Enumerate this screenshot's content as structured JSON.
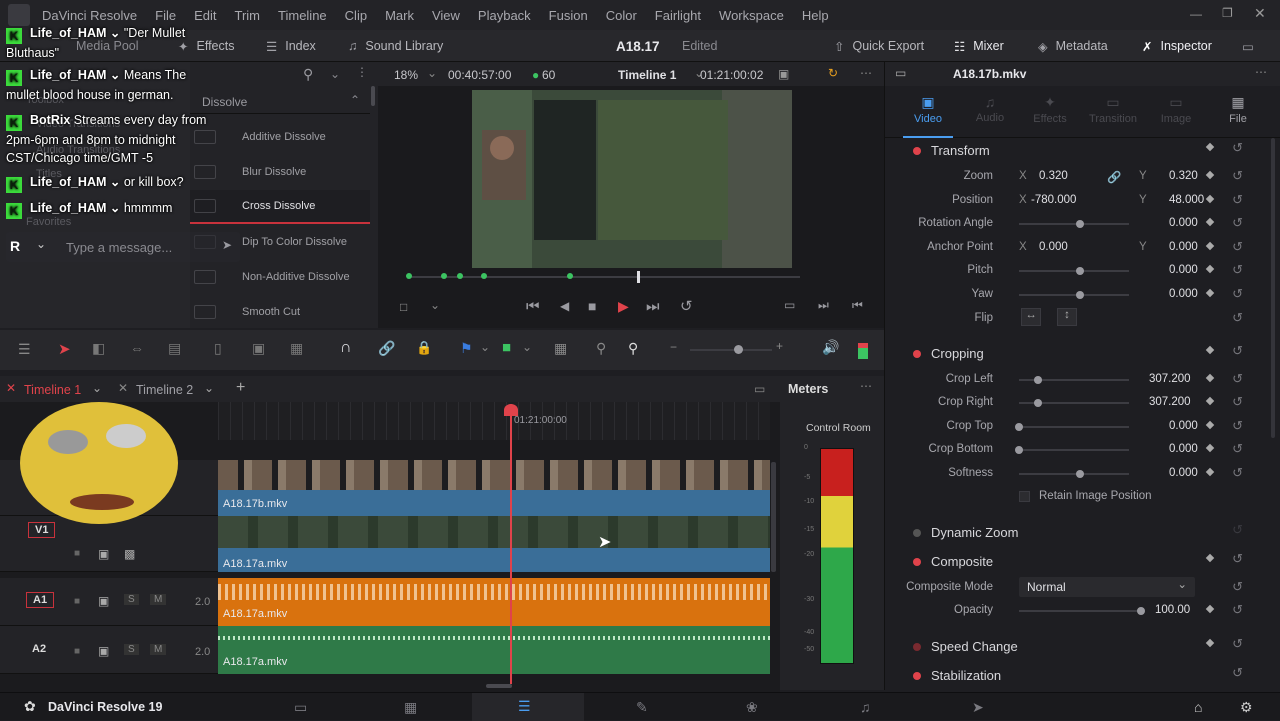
{
  "menu": {
    "app": "DaVinci Resolve",
    "items": [
      "File",
      "Edit",
      "Trim",
      "Timeline",
      "Clip",
      "Mark",
      "View",
      "Playback",
      "Fusion",
      "Color",
      "Fairlight",
      "Workspace",
      "Help"
    ]
  },
  "toolbar": {
    "media_pool": "Media Pool",
    "effects": "Effects",
    "index": "Index",
    "sound_library": "Sound Library",
    "project_name": "A18.17",
    "project_status": "Edited",
    "quick_export": "Quick Export",
    "mixer": "Mixer",
    "metadata": "Metadata",
    "inspector": "Inspector"
  },
  "effects": {
    "sidebar": [
      "Toolbox",
      "Video Transitions",
      "Audio Transitions",
      "Titles",
      "Favorites"
    ],
    "group": "Dissolve",
    "items": [
      "Additive Dissolve",
      "Blur Dissolve",
      "Cross Dissolve",
      "Dip To Color Dissolve",
      "Non-Additive Dissolve",
      "Smooth Cut"
    ],
    "selected": "Cross Dissolve"
  },
  "chat": {
    "messages": [
      {
        "user": "Life_of_HAM",
        "text": "\"Der Mullet Bluthaus\""
      },
      {
        "user": "Life_of_HAM",
        "text": "Means The mullet blood house in german."
      },
      {
        "user": "BotRix",
        "text": "Streams every day from 2pm-6pm and 8pm to midnight CST/Chicago time/GMT -5"
      },
      {
        "user": "Life_of_HAM",
        "text": "or kill box?"
      },
      {
        "user": "Life_of_HAM",
        "text": "hmmmm"
      }
    ],
    "input_initial": "R",
    "input_placeholder": "Type a message..."
  },
  "viewer": {
    "zoom": "18%",
    "source_tc": "00:40:57:00",
    "fps": "60",
    "timeline_name": "Timeline 1",
    "record_tc": "01:21:00:02"
  },
  "inspector": {
    "clip_name": "A18.17b.mkv",
    "tabs": [
      "Video",
      "Audio",
      "Effects",
      "Transition",
      "Image",
      "File"
    ],
    "active_tab": "Video",
    "transform": {
      "title": "Transform",
      "zoom_label": "Zoom",
      "zoom_x": "0.320",
      "zoom_y": "0.320",
      "position_label": "Position",
      "position_x": "-780.000",
      "position_y": "48.000",
      "rotation_label": "Rotation Angle",
      "rotation": "0.000",
      "anchor_label": "Anchor Point",
      "anchor_x": "0.000",
      "anchor_y": "0.000",
      "pitch_label": "Pitch",
      "pitch": "0.000",
      "yaw_label": "Yaw",
      "yaw": "0.000",
      "flip_label": "Flip",
      "x_axis": "X",
      "y_axis": "Y"
    },
    "cropping": {
      "title": "Cropping",
      "left_label": "Crop Left",
      "left": "307.200",
      "right_label": "Crop Right",
      "right": "307.200",
      "top_label": "Crop Top",
      "top": "0.000",
      "bottom_label": "Crop Bottom",
      "bottom": "0.000",
      "softness_label": "Softness",
      "softness": "0.000",
      "retain_label": "Retain Image Position"
    },
    "dynamic_zoom": "Dynamic Zoom",
    "composite": {
      "title": "Composite",
      "mode_label": "Composite Mode",
      "mode": "Normal",
      "opacity_label": "Opacity",
      "opacity": "100.00"
    },
    "speed_change": "Speed Change",
    "stabilization": "Stabilization"
  },
  "timeline": {
    "tabs": [
      "Timeline 1",
      "Timeline 2"
    ],
    "playhead_tc": "01:21:00:00",
    "v_track": "V1",
    "tracks": [
      {
        "name": "A1",
        "level": "2.0",
        "clip": "A18.17a.mkv"
      },
      {
        "name": "A2",
        "level": "2.0",
        "clip": "A18.17a.mkv"
      }
    ],
    "clip_v2": "A18.17b.mkv",
    "clip_v1": "A18.17a.mkv"
  },
  "meters": {
    "title": "Meters",
    "label": "Control Room",
    "scale": [
      "0",
      "-5",
      "-10",
      "-15",
      "-20",
      "-30",
      "-40",
      "-50"
    ]
  },
  "bottom": {
    "app_name": "DaVinci Resolve 19"
  },
  "colors": {
    "accent_red": "#e0434b",
    "audio_orange": "#d9720e",
    "audio_green": "#2f7a48",
    "video_blue": "#3a6e98",
    "kick_green": "#3cdc3c"
  }
}
